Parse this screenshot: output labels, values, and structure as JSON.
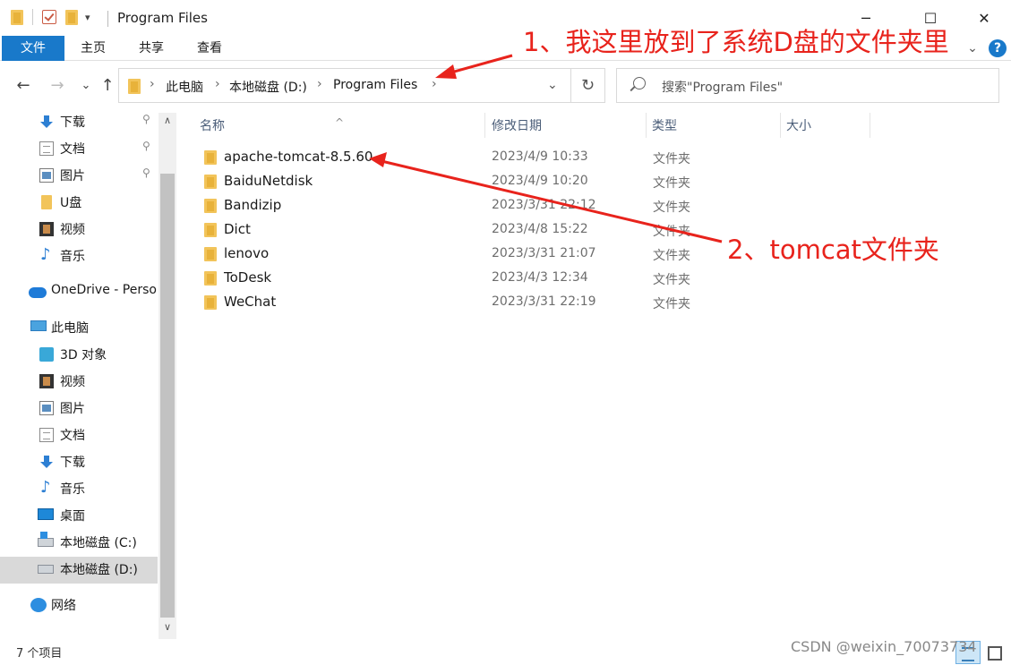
{
  "window": {
    "title": "Program Files",
    "minimize_glyph": "─",
    "maximize_glyph": "☐",
    "close_glyph": "✕",
    "qa_dropdown_glyph": "▾"
  },
  "ribbon": {
    "tabs": [
      "文件",
      "主页",
      "共享",
      "查看"
    ],
    "expand_glyph": "⌄",
    "help_glyph": "?",
    "accent": "#1979ca"
  },
  "nav": {
    "back_glyph": "←",
    "forward_glyph": "→",
    "recent_glyph": "⌄",
    "up_glyph": "↑",
    "breadcrumb": [
      "此电脑",
      "本地磁盘 (D:)",
      "Program Files"
    ],
    "separator_glyph": "›",
    "dropdown_glyph": "⌄",
    "refresh_glyph": "↻",
    "search_placeholder": "搜索\"Program Files\""
  },
  "sidebar": {
    "items": [
      {
        "label": "下载",
        "icon": "download-icon",
        "pinned": true
      },
      {
        "label": "文档",
        "icon": "document-icon",
        "pinned": true
      },
      {
        "label": "图片",
        "icon": "picture-icon",
        "pinned": true
      },
      {
        "label": "U盘",
        "icon": "folder-icon",
        "pinned": false
      },
      {
        "label": "视频",
        "icon": "video-icon",
        "pinned": false
      },
      {
        "label": "音乐",
        "icon": "music-icon",
        "pinned": false
      },
      {
        "label": "OneDrive - Perso",
        "icon": "onedrive-icon",
        "pinned": false
      },
      {
        "label": "此电脑",
        "icon": "computer-icon",
        "pinned": false
      },
      {
        "label": "3D 对象",
        "icon": "3d-objects-icon",
        "pinned": false
      },
      {
        "label": "视频",
        "icon": "video-icon",
        "pinned": false
      },
      {
        "label": "图片",
        "icon": "picture-icon",
        "pinned": false
      },
      {
        "label": "文档",
        "icon": "document-icon",
        "pinned": false
      },
      {
        "label": "下载",
        "icon": "download-icon",
        "pinned": false
      },
      {
        "label": "音乐",
        "icon": "music-icon",
        "pinned": false
      },
      {
        "label": "桌面",
        "icon": "desktop-icon",
        "pinned": false
      },
      {
        "label": "本地磁盘 (C:)",
        "icon": "drive-c-icon",
        "pinned": false
      },
      {
        "label": "本地磁盘 (D:)",
        "icon": "drive-d-icon",
        "pinned": false,
        "selected": true
      },
      {
        "label": "网络",
        "icon": "network-icon",
        "pinned": false
      }
    ],
    "pin_glyph": "📌",
    "scroll_up_glyph": "∧",
    "scroll_down_glyph": "∨"
  },
  "columns": {
    "name": "名称",
    "date": "修改日期",
    "type": "类型",
    "size": "大小",
    "sort_glyph": "^"
  },
  "files": [
    {
      "name": "apache-tomcat-8.5.60",
      "date": "2023/4/9 10:33",
      "type": "文件夹"
    },
    {
      "name": "BaiduNetdisk",
      "date": "2023/4/9 10:20",
      "type": "文件夹"
    },
    {
      "name": "Bandizip",
      "date": "2023/3/31 22:12",
      "type": "文件夹"
    },
    {
      "name": "Dict",
      "date": "2023/4/8 15:22",
      "type": "文件夹"
    },
    {
      "name": "lenovo",
      "date": "2023/3/31 21:07",
      "type": "文件夹"
    },
    {
      "name": "ToDesk",
      "date": "2023/4/3 12:34",
      "type": "文件夹"
    },
    {
      "name": "WeChat",
      "date": "2023/3/31 22:19",
      "type": "文件夹"
    }
  ],
  "status": {
    "item_count": "7 个项目"
  },
  "annotations": {
    "note1": "1、我这里放到了系统D盘的文件夹里",
    "note2": "2、tomcat文件夹",
    "color": "#e8231c"
  },
  "watermark": "CSDN @weixin_70073734"
}
